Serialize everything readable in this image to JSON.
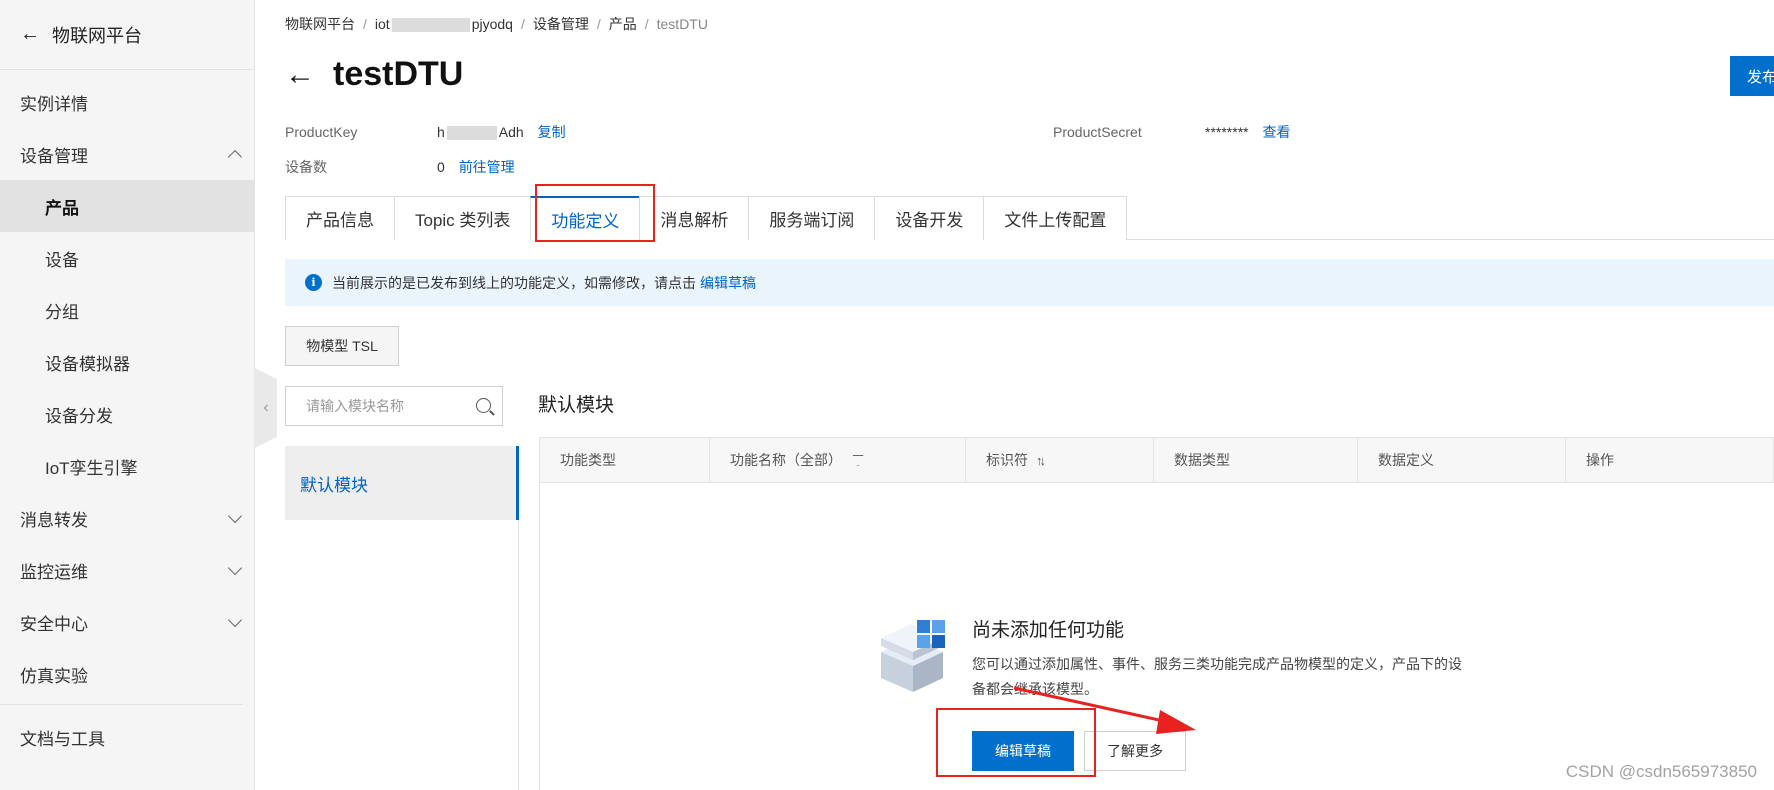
{
  "sidebar": {
    "header": "物联网平台",
    "items": [
      {
        "label": "实例详情"
      },
      {
        "label": "设备管理"
      },
      {
        "label": "产品"
      },
      {
        "label": "设备"
      },
      {
        "label": "分组"
      },
      {
        "label": "设备模拟器"
      },
      {
        "label": "设备分发"
      },
      {
        "label": "IoT孪生引擎"
      },
      {
        "label": "消息转发"
      },
      {
        "label": "监控运维"
      },
      {
        "label": "安全中心"
      },
      {
        "label": "仿真实验"
      },
      {
        "label": "文档与工具"
      }
    ]
  },
  "breadcrumb": {
    "items": [
      "物联网平台",
      "iot",
      "pjyodq",
      "设备管理",
      "产品",
      "testDTU"
    ]
  },
  "header": {
    "title": "testDTU",
    "publish_label": "发布"
  },
  "meta": {
    "product_key_label": "ProductKey",
    "product_key_prefix": "h",
    "product_key_suffix": "Adh",
    "copy_label": "复制",
    "product_secret_label": "ProductSecret",
    "product_secret_value": "********",
    "view_label": "查看",
    "device_count_label": "设备数",
    "device_count_value": "0",
    "manage_label": "前往管理"
  },
  "tabs": [
    {
      "label": "产品信息"
    },
    {
      "label": "Topic 类列表"
    },
    {
      "label": "功能定义",
      "active": true
    },
    {
      "label": "消息解析"
    },
    {
      "label": "服务端订阅"
    },
    {
      "label": "设备开发"
    },
    {
      "label": "文件上传配置"
    }
  ],
  "notice": {
    "text": "当前展示的是已发布到线上的功能定义，如需修改，请点击",
    "link": "编辑草稿"
  },
  "tsl_button": "物模型 TSL",
  "module_panel": {
    "search_placeholder": "请输入模块名称",
    "modules": [
      "默认模块"
    ]
  },
  "content": {
    "section_title": "默认模块",
    "columns": [
      "功能类型",
      "功能名称（全部）",
      "标识符",
      "数据类型",
      "数据定义",
      "操作"
    ]
  },
  "empty_state": {
    "title": "尚未添加任何功能",
    "description": "您可以通过添加属性、事件、服务三类功能完成产品物模型的定义，产品下的设备都会继承该模型。",
    "primary_button": "编辑草稿",
    "secondary_button": "了解更多"
  },
  "watermark": "CSDN @csdn565973850",
  "colors": {
    "accent": "#0070cc",
    "link": "#0064c8",
    "annotation": "#e8231f",
    "notice_bg": "#e9f4fd"
  }
}
